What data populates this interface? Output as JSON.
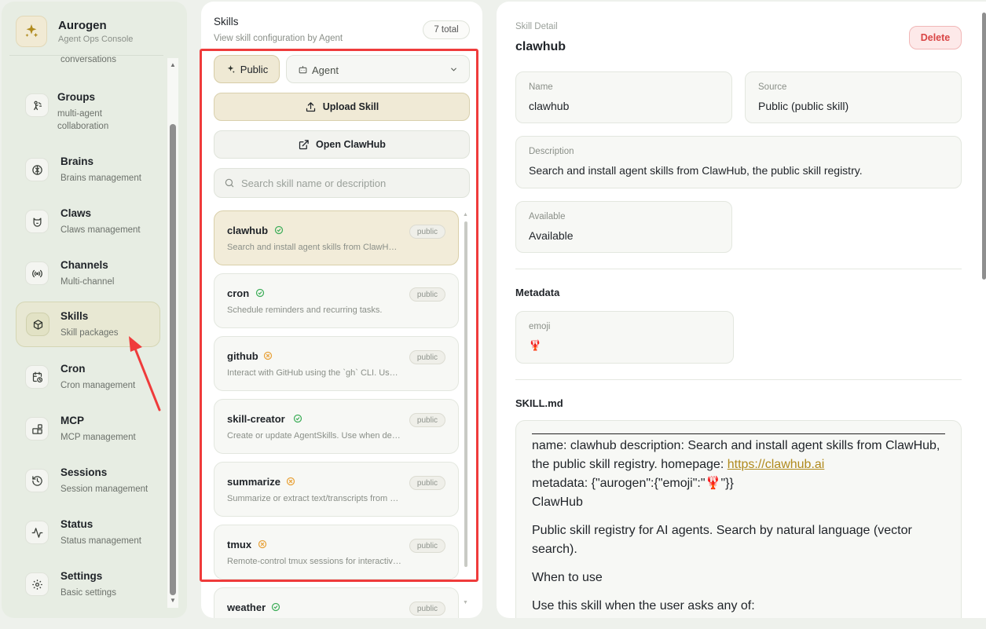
{
  "brand": {
    "title": "Aurogen",
    "subtitle": "Agent Ops Console"
  },
  "sidebar": {
    "partial_item": "conversations",
    "items": [
      {
        "title": "Groups",
        "subtitle": "multi-agent collaboration",
        "icon": "groups-icon"
      },
      {
        "title": "Brains",
        "subtitle": "Brains management",
        "icon": "brain-icon"
      },
      {
        "title": "Claws",
        "subtitle": "Claws management",
        "icon": "claw-icon"
      },
      {
        "title": "Channels",
        "subtitle": "Multi-channel",
        "icon": "broadcast-icon"
      },
      {
        "title": "Skills",
        "subtitle": "Skill packages",
        "icon": "package-icon",
        "active": true
      },
      {
        "title": "Cron",
        "subtitle": "Cron management",
        "icon": "calendar-clock-icon"
      },
      {
        "title": "MCP",
        "subtitle": "MCP management",
        "icon": "blocks-icon"
      },
      {
        "title": "Sessions",
        "subtitle": "Session management",
        "icon": "history-icon"
      },
      {
        "title": "Status",
        "subtitle": "Status management",
        "icon": "activity-icon"
      },
      {
        "title": "Settings",
        "subtitle": "Basic settings",
        "icon": "gear-icon"
      }
    ]
  },
  "skills_panel": {
    "title": "Skills",
    "subtitle": "View skill configuration by Agent",
    "count": "7 total",
    "filter_public": "Public",
    "agent_select": "Agent",
    "upload_label": "Upload Skill",
    "clawhub_label": "Open ClawHub",
    "search_placeholder": "Search skill name or description",
    "skills": [
      {
        "name": "clawhub",
        "desc": "Search and install agent skills from ClawHub, the public skill registry.",
        "badge": "public",
        "status": "ok",
        "active": true
      },
      {
        "name": "cron",
        "desc": "Schedule reminders and recurring tasks.",
        "badge": "public",
        "status": "ok"
      },
      {
        "name": "github",
        "desc": "Interact with GitHub using the `gh` CLI. Use gh issue, gh pr, gh run.",
        "badge": "public",
        "status": "warn"
      },
      {
        "name": "skill-creator",
        "desc": "Create or update AgentSkills. Use when designing skills.",
        "badge": "public",
        "status": "ok"
      },
      {
        "name": "summarize",
        "desc": "Summarize or extract text/transcripts from URLs.",
        "badge": "public",
        "status": "warn"
      },
      {
        "name": "tmux",
        "desc": "Remote-control tmux sessions for interactive CLIs.",
        "badge": "public",
        "status": "warn"
      },
      {
        "name": "weather",
        "desc": "",
        "badge": "public",
        "status": "ok"
      }
    ]
  },
  "detail": {
    "label": "Skill Detail",
    "title": "clawhub",
    "delete_label": "Delete",
    "name_label": "Name",
    "name_value": "clawhub",
    "source_label": "Source",
    "source_value": "Public (public skill)",
    "desc_label": "Description",
    "desc_value": "Search and install agent skills from ClawHub, the public skill registry.",
    "avail_label": "Available",
    "avail_value": "Available",
    "metadata_section": "Metadata",
    "emoji_label": "emoji",
    "emoji_value": "🦞",
    "skillmd_section": "SKILL.md",
    "md_line1": "name: clawhub description: Search and install agent skills from ClawHub, the public skill registry. homepage: ",
    "md_link": "https://clawhub.ai",
    "md_line2": "metadata: {\"aurogen\":{\"emoji\":\"🦞\"}}",
    "md_heading": "ClawHub",
    "md_para": "Public skill registry for AI agents. Search by natural language (vector search).",
    "md_when": "When to use",
    "md_use": "Use this skill when the user asks any of:"
  },
  "colors": {
    "accent": "#b08a1d",
    "highlight": "#ef3b3b",
    "ok": "#3fae5a",
    "warn": "#e8a23a",
    "danger": "#d94545"
  }
}
